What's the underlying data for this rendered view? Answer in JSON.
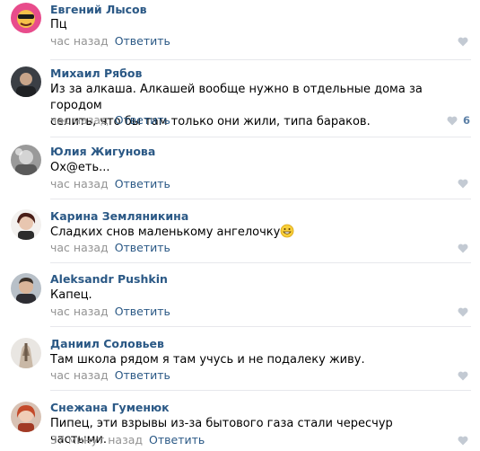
{
  "comments": [
    {
      "author": "Евгений Лысов",
      "text": "Пц",
      "time": "час назад",
      "reply": "Ответить",
      "likes": "",
      "avatar": "avatar-pink"
    },
    {
      "author": "Михаил Рябов",
      "text": "Из за алкаша. Алкашей вообще нужно в отдельные дома за городом\nселить, что бы там только они жили, типа бараков.",
      "time": "час назад",
      "reply": "Ответить",
      "likes": "6",
      "avatar": "avatar-dark"
    },
    {
      "author": "Юлия Жигунова",
      "text": "Ох@еть...",
      "time": "час назад",
      "reply": "Ответить",
      "likes": "",
      "avatar": "avatar-grey"
    },
    {
      "author": "Карина Земляникина",
      "text": "Сладких снов маленькому ангелочку",
      "time": "час назад",
      "reply": "Ответить",
      "likes": "",
      "avatar": "avatar-photo"
    },
    {
      "author": "Aleksandr Pushkin",
      "text": "Капец.",
      "time": "час назад",
      "reply": "Ответить",
      "likes": "",
      "avatar": "avatar-man"
    },
    {
      "author": "Даниил Соловьев",
      "text": "Там школа рядом я там учусь и не подалеку живу.",
      "time": "час назад",
      "reply": "Ответить",
      "likes": "",
      "avatar": "avatar-hands"
    },
    {
      "author": "Снежана Гуменюк",
      "text": "Пипец, эти взрывы из-за бытового газа стали чересчур частыми.",
      "time": "37 минут назад",
      "reply": "Ответить",
      "likes": "",
      "avatar": "avatar-woman"
    }
  ]
}
